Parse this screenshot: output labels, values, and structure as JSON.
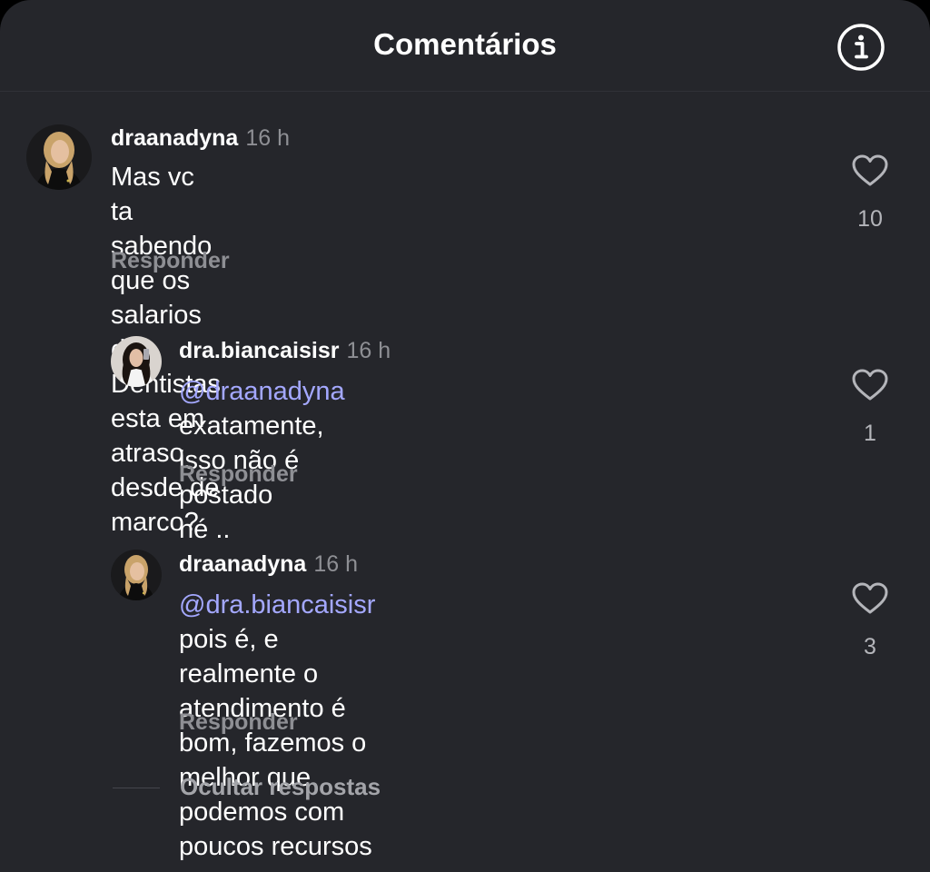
{
  "header": {
    "title": "Comentários"
  },
  "comments": [
    {
      "username": "draanadyna",
      "time": "16 h",
      "mention": "",
      "text_line1": "Mas vc ta sabendo que os salarios dos Dentistas",
      "text_line2": "esta em atraso desde de marco?",
      "text_line3": "",
      "reply_label": "Responder",
      "likes": "10"
    },
    {
      "username": "dra.biancaisisr",
      "time": "16 h",
      "mention": "@draanadyna",
      "text_line1": "exatamente, isso não é postado",
      "text_line2": "né ..",
      "text_line3": "",
      "reply_label": "Responder",
      "likes": "1"
    },
    {
      "username": "draanadyna",
      "time": "16 h",
      "mention": "@dra.biancaisisr",
      "text_line1": "pois é, e realmente o",
      "text_line2": "atendimento é bom, fazemos o melhor que",
      "text_line3": "podemos com poucos recursos",
      "reply_label": "Responder",
      "likes": "3"
    }
  ],
  "hide_replies_label": "Ocultar respostas",
  "colors": {
    "background": "#25262b",
    "mention": "#a4a8ff",
    "muted": "#8e8f94"
  }
}
